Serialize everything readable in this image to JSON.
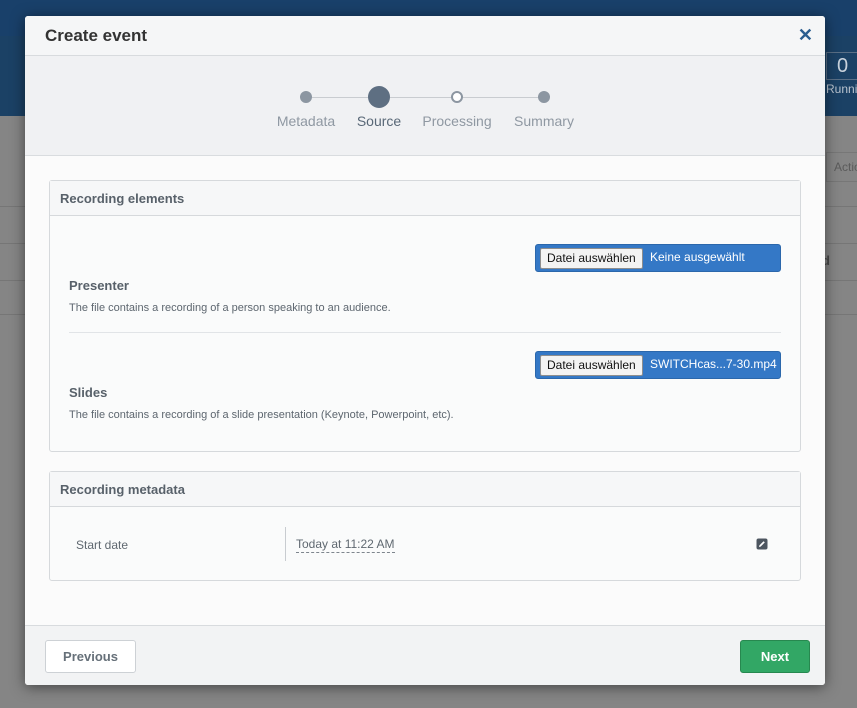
{
  "background": {
    "counter": "0",
    "running_label": "Running",
    "actions_label": "Actions",
    "column_fragment": "d"
  },
  "modal": {
    "title": "Create event",
    "close_symbol": "✕",
    "wizard": {
      "steps": [
        {
          "label": "Metadata",
          "state": "done"
        },
        {
          "label": "Source",
          "state": "active"
        },
        {
          "label": "Processing",
          "state": "pending"
        },
        {
          "label": "Summary",
          "state": "upcoming"
        }
      ]
    },
    "recording_elements": {
      "title": "Recording elements",
      "items": [
        {
          "title": "Presenter",
          "description": "The file contains a recording of a person speaking to an audience.",
          "button_label": "Datei auswählen",
          "file_name": "Keine ausgewählt"
        },
        {
          "title": "Slides",
          "description": "The file contains a recording of a slide presentation (Keynote, Powerpoint, etc).",
          "button_label": "Datei auswählen",
          "file_name": "SWITCHcas...7-30.mp4"
        }
      ]
    },
    "recording_metadata": {
      "title": "Recording metadata",
      "start_date_label": "Start date",
      "start_date_value": "Today at 11:22 AM"
    },
    "footer": {
      "previous_label": "Previous",
      "next_label": "Next"
    }
  },
  "colors": {
    "primary": "#3478c6",
    "success": "#32a765",
    "header_dark": "#19406a"
  }
}
